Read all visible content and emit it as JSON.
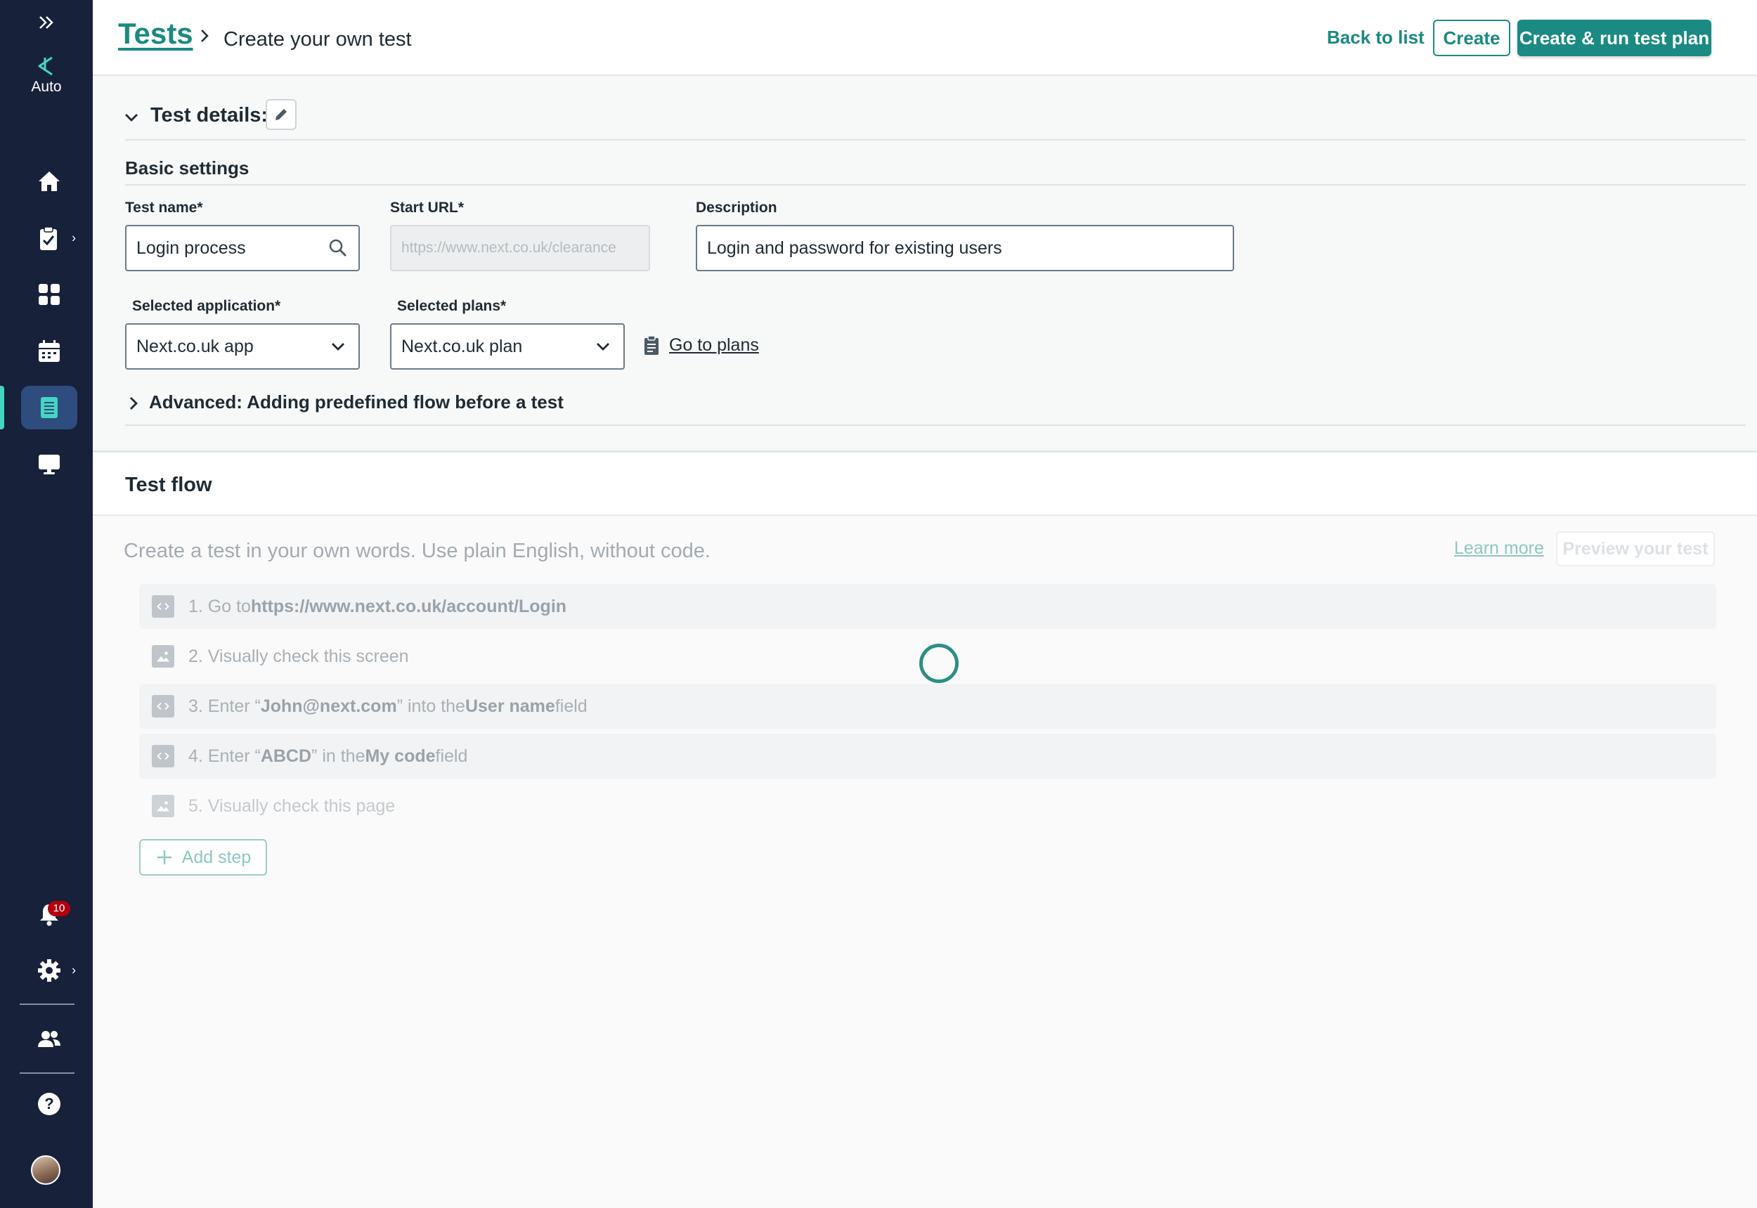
{
  "sidebar": {
    "logo_label": "Auto",
    "notification_count": "10"
  },
  "header": {
    "breadcrumb_root": "Tests",
    "breadcrumb_current": "Create your own test",
    "back_to_list": "Back to list",
    "create": "Create",
    "create_and_run": "Create & run test plan"
  },
  "details": {
    "title": "Test details:",
    "basic_settings": "Basic settings",
    "test_name": {
      "label": "Test name*",
      "value": "Login process"
    },
    "start_url": {
      "label": "Start URL*",
      "value": "https://www.next.co.uk/clearance"
    },
    "description": {
      "label": "Description",
      "value": "Login and password for existing users"
    },
    "application": {
      "label": "Selected application*",
      "value": "Next.co.uk app"
    },
    "plans": {
      "label": "Selected plans*",
      "value": "Next.co.uk plan"
    },
    "go_to_plans": "Go to plans",
    "advanced": "Advanced: Adding predefined flow before a test"
  },
  "flow": {
    "title": "Test flow",
    "hint": "Create a test in your own words. Use plain English, without code.",
    "learn_more": "Learn more",
    "preview": "Preview your test",
    "add_step": "Add step",
    "steps": [
      {
        "icon": "code-icon",
        "prefix": "1. Go to ",
        "strong1": "https://www.next.co.uk/account/Login",
        "mid": "",
        "strong2": "",
        "suffix": ""
      },
      {
        "icon": "image-icon",
        "prefix": "2. Visually check this screen",
        "strong1": "",
        "mid": "",
        "strong2": "",
        "suffix": ""
      },
      {
        "icon": "code-icon",
        "prefix": "3. Enter “",
        "strong1": "John@next.com",
        "mid": "” into the ",
        "strong2": "User name",
        "suffix": " field"
      },
      {
        "icon": "code-icon",
        "prefix": "4. Enter “",
        "strong1": "ABCD",
        "mid": "” in the ",
        "strong2": "My code",
        "suffix": " field"
      },
      {
        "icon": "image-icon",
        "prefix": "5. Visually check this page",
        "strong1": "",
        "mid": "",
        "strong2": "",
        "suffix": ""
      }
    ]
  },
  "colors": {
    "sidebar_bg": "#17213a",
    "accent": "#1a8a82",
    "active_indicator": "#45d6c1",
    "badge": "#b3000f"
  }
}
